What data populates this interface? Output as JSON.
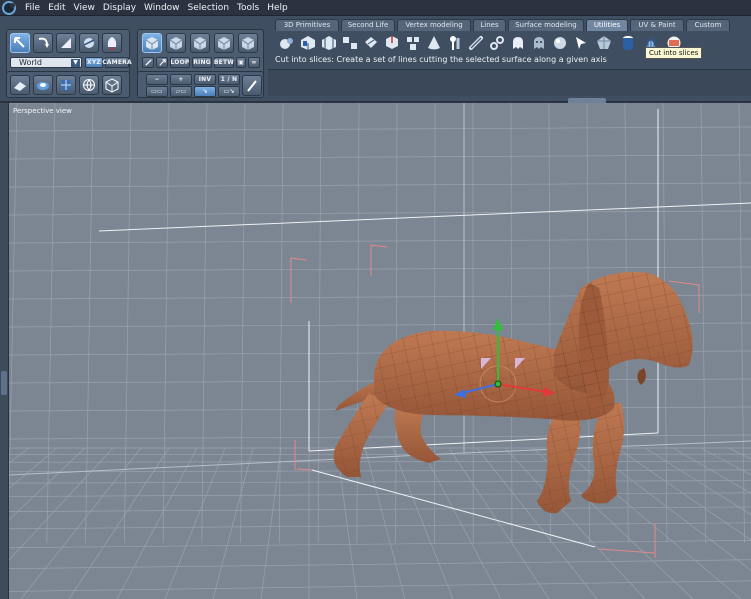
{
  "menu": [
    "File",
    "Edit",
    "View",
    "Display",
    "Window",
    "Selection",
    "Tools",
    "Help"
  ],
  "tools": {
    "coord_select": "World",
    "xyz_label": "XYZ",
    "camera_label": "CAMERA",
    "loop_label": "LOOP",
    "ring_label": "RING",
    "betw_label": "BETW",
    "minus_label": "−",
    "plus_label": "+",
    "inv_label": "INV",
    "one_n_label": "1 / N"
  },
  "tabs": [
    {
      "label": "3D Primitives",
      "active": false
    },
    {
      "label": "Second Life",
      "active": false
    },
    {
      "label": "Vertex modeling",
      "active": false
    },
    {
      "label": "Lines",
      "active": false
    },
    {
      "label": "Surface modeling",
      "active": false
    },
    {
      "label": "Utilities",
      "active": true
    },
    {
      "label": "UV & Paint",
      "active": false
    },
    {
      "label": "Custom",
      "active": false
    }
  ],
  "status_text": "Cut into slices: Create a set of lines cutting the selected surface along a given axis",
  "tooltip_text": "Cut into slices",
  "viewport": {
    "label": "Perspective view"
  },
  "colors": {
    "accent": "#7fb2e6",
    "model": "#b5714a",
    "grid": "#9aa2ad",
    "axis_x": "#e23a3a",
    "axis_y": "#2fbf3a",
    "axis_z": "#3c6fe0"
  }
}
